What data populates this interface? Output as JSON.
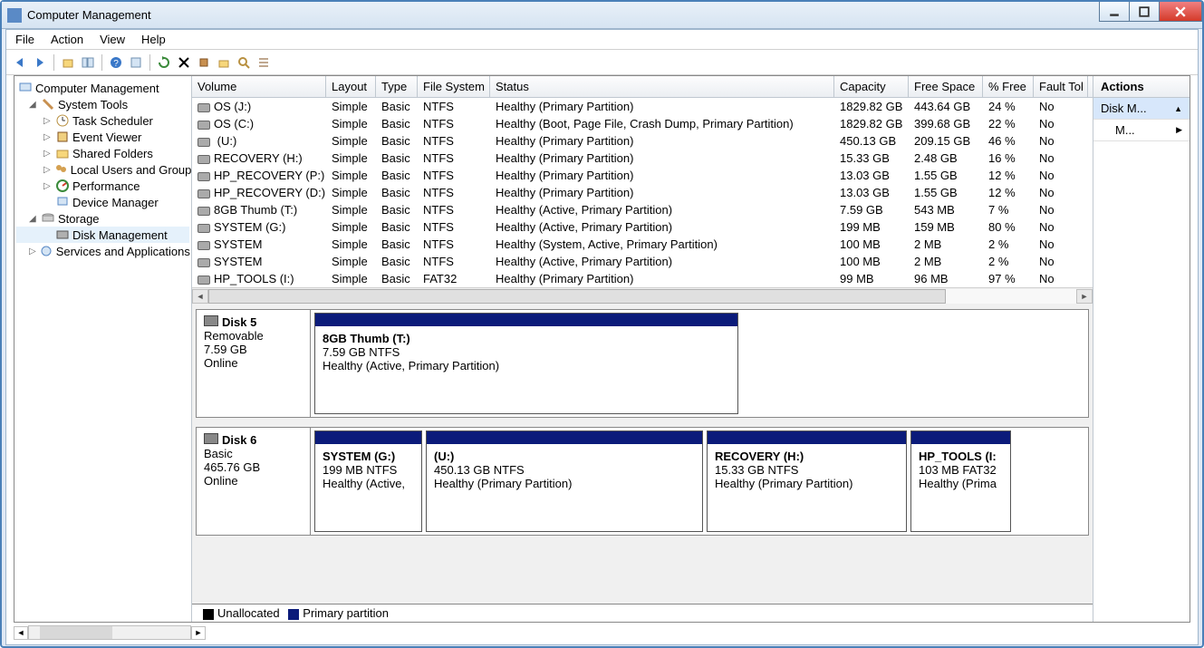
{
  "window": {
    "title": "Computer Management"
  },
  "menubar": [
    "File",
    "Action",
    "View",
    "Help"
  ],
  "tree": {
    "root": "Computer Management",
    "items": [
      {
        "label": "System Tools",
        "expanded": true,
        "children": [
          {
            "label": "Task Scheduler"
          },
          {
            "label": "Event Viewer"
          },
          {
            "label": "Shared Folders"
          },
          {
            "label": "Local Users and Groups"
          },
          {
            "label": "Performance"
          },
          {
            "label": "Device Manager"
          }
        ]
      },
      {
        "label": "Storage",
        "expanded": true,
        "children": [
          {
            "label": "Disk Management",
            "selected": true
          }
        ]
      },
      {
        "label": "Services and Applications",
        "expanded": false
      }
    ]
  },
  "volumes": {
    "headers": [
      "Volume",
      "Layout",
      "Type",
      "File System",
      "Status",
      "Capacity",
      "Free Space",
      "% Free",
      "Fault Tol"
    ],
    "rows": [
      {
        "vol": "OS (J:)",
        "lay": "Simple",
        "typ": "Basic",
        "fs": "NTFS",
        "stat": "Healthy (Primary Partition)",
        "cap": "1829.82 GB",
        "free": "443.64 GB",
        "pct": "24 %",
        "ft": "No"
      },
      {
        "vol": "OS (C:)",
        "lay": "Simple",
        "typ": "Basic",
        "fs": "NTFS",
        "stat": "Healthy (Boot, Page File, Crash Dump, Primary Partition)",
        "cap": "1829.82 GB",
        "free": "399.68 GB",
        "pct": "22 %",
        "ft": "No"
      },
      {
        "vol": " (U:)",
        "lay": "Simple",
        "typ": "Basic",
        "fs": "NTFS",
        "stat": "Healthy (Primary Partition)",
        "cap": "450.13 GB",
        "free": "209.15 GB",
        "pct": "46 %",
        "ft": "No"
      },
      {
        "vol": "RECOVERY (H:)",
        "lay": "Simple",
        "typ": "Basic",
        "fs": "NTFS",
        "stat": "Healthy (Primary Partition)",
        "cap": "15.33 GB",
        "free": "2.48 GB",
        "pct": "16 %",
        "ft": "No"
      },
      {
        "vol": "HP_RECOVERY (P:)",
        "lay": "Simple",
        "typ": "Basic",
        "fs": "NTFS",
        "stat": "Healthy (Primary Partition)",
        "cap": "13.03 GB",
        "free": "1.55 GB",
        "pct": "12 %",
        "ft": "No"
      },
      {
        "vol": "HP_RECOVERY (D:)",
        "lay": "Simple",
        "typ": "Basic",
        "fs": "NTFS",
        "stat": "Healthy (Primary Partition)",
        "cap": "13.03 GB",
        "free": "1.55 GB",
        "pct": "12 %",
        "ft": "No"
      },
      {
        "vol": "8GB Thumb (T:)",
        "lay": "Simple",
        "typ": "Basic",
        "fs": "NTFS",
        "stat": "Healthy (Active, Primary Partition)",
        "cap": "7.59 GB",
        "free": "543 MB",
        "pct": "7 %",
        "ft": "No"
      },
      {
        "vol": "SYSTEM (G:)",
        "lay": "Simple",
        "typ": "Basic",
        "fs": "NTFS",
        "stat": "Healthy (Active, Primary Partition)",
        "cap": "199 MB",
        "free": "159 MB",
        "pct": "80 %",
        "ft": "No"
      },
      {
        "vol": "SYSTEM",
        "lay": "Simple",
        "typ": "Basic",
        "fs": "NTFS",
        "stat": "Healthy (System, Active, Primary Partition)",
        "cap": "100 MB",
        "free": "2 MB",
        "pct": "2 %",
        "ft": "No"
      },
      {
        "vol": "SYSTEM",
        "lay": "Simple",
        "typ": "Basic",
        "fs": "NTFS",
        "stat": "Healthy (Active, Primary Partition)",
        "cap": "100 MB",
        "free": "2 MB",
        "pct": "2 %",
        "ft": "No"
      },
      {
        "vol": "HP_TOOLS (I:)",
        "lay": "Simple",
        "typ": "Basic",
        "fs": "FAT32",
        "stat": "Healthy (Primary Partition)",
        "cap": "99 MB",
        "free": "96 MB",
        "pct": "97 %",
        "ft": "No"
      }
    ]
  },
  "disks": [
    {
      "name": "Disk 5",
      "type": "Removable",
      "size": "7.59 GB",
      "state": "Online",
      "partitions": [
        {
          "name": "8GB Thumb  (T:)",
          "detail": "7.59 GB NTFS",
          "status": "Healthy (Active, Primary Partition)",
          "width": "55%"
        }
      ]
    },
    {
      "name": "Disk 6",
      "type": "Basic",
      "size": "465.76 GB",
      "state": "Online",
      "partitions": [
        {
          "name": "SYSTEM  (G:)",
          "detail": "199 MB NTFS",
          "status": "Healthy (Active,",
          "width": "14%"
        },
        {
          "name": " (U:)",
          "detail": "450.13 GB NTFS",
          "status": "Healthy (Primary Partition)",
          "width": "36%"
        },
        {
          "name": "RECOVERY  (H:)",
          "detail": "15.33 GB NTFS",
          "status": "Healthy (Primary Partition)",
          "width": "26%"
        },
        {
          "name": "HP_TOOLS  (I:",
          "detail": "103 MB FAT32",
          "status": "Healthy (Prima",
          "width": "13%"
        }
      ]
    }
  ],
  "legend": {
    "unallocated": "Unallocated",
    "primary": "Primary partition"
  },
  "actions": {
    "header": "Actions",
    "items": [
      {
        "label": "Disk M...",
        "collapsed": true
      },
      {
        "label": "M...",
        "hasMore": true
      }
    ]
  }
}
